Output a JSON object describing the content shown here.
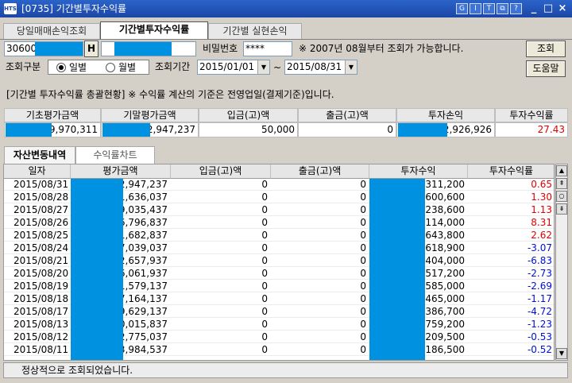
{
  "window": {
    "title": "[0735] 기간별투자수익률",
    "app_badge": "HTS",
    "toolbar_buttons": [
      "G",
      "I",
      "T",
      "⧉",
      "?"
    ],
    "minimize": "_",
    "restore": "□",
    "close": "×"
  },
  "tabs": [
    "당일매매손익조회",
    "기간별투자수익률",
    "기간별 실현손익"
  ],
  "active_tab": 1,
  "form": {
    "account_value": "30600",
    "account_suffix": "H",
    "password_label": "비밀번호",
    "password_value": "****",
    "notice": "※ 2007년 08월부터 조회가 가능합니다.",
    "query_button": "조회",
    "help_button": "도움말",
    "type_label": "조회구분",
    "radio_daily": "일별",
    "radio_monthly": "월별",
    "period_label": "조회기간",
    "start_date": "2015/01/01",
    "tilde": "~",
    "end_date": "2015/08/31"
  },
  "summary": {
    "note": "[기간별 투자수익률 총괄현황] ※ 수익률 계산의 기준은 전영업일(결제기준)입니다.",
    "headers": [
      "기초평가금액",
      "기말평가금액",
      "입금(고)액",
      "출금(고)액",
      "투자손익",
      "투자수익률"
    ],
    "values": [
      "19,970,311",
      "2,947,237",
      "50,000",
      "0",
      "2,926,926",
      "27.43"
    ]
  },
  "subtabs": [
    "자산변동내역",
    "수익률차트"
  ],
  "grid": {
    "columns": [
      "일자",
      "평가금액",
      "입금(고)액",
      "출금(고)액",
      "투자수익",
      "투자수익률"
    ],
    "rows": [
      [
        "2015/08/31",
        "2,947,237",
        "0",
        "0",
        ",311,200",
        "0.65"
      ],
      [
        "2015/08/28",
        "1,636,037",
        "0",
        "0",
        ",600,600",
        "1.30"
      ],
      [
        "2015/08/27",
        "9,035,437",
        "0",
        "0",
        ",238,600",
        "1.13"
      ],
      [
        "2015/08/26",
        "6,796,837",
        "0",
        "0",
        ",114,000",
        "8.31"
      ],
      [
        "2015/08/25",
        "1,682,837",
        "0",
        "0",
        ",643,800",
        "2.62"
      ],
      [
        "2015/08/24",
        "7,039,037",
        "0",
        "0",
        ",618,900",
        "-3.07"
      ],
      [
        "2015/08/21",
        "2,657,937",
        "0",
        "0",
        ",404,000",
        "-6.83"
      ],
      [
        "2015/08/20",
        "6,061,937",
        "0",
        "0",
        ",517,200",
        "-2.73"
      ],
      [
        "2015/08/19",
        "1,579,137",
        "0",
        "0",
        ",585,000",
        "-2.69"
      ],
      [
        "2015/08/18",
        "7,164,137",
        "0",
        "0",
        ",465,000",
        "-1.17"
      ],
      [
        "2015/08/17",
        "9,629,137",
        "0",
        "0",
        ",386,700",
        "-4.72"
      ],
      [
        "2015/08/13",
        "0,015,837",
        "0",
        "0",
        ",759,200",
        "-1.23"
      ],
      [
        "2015/08/12",
        "2,775,037",
        "0",
        "0",
        ",209,500",
        "-0.53"
      ],
      [
        "2015/08/11",
        "3,984,537",
        "0",
        "0",
        ",186,500",
        "-0.52"
      ]
    ]
  },
  "status": "정상적으로 조회되었습니다.",
  "colors": {
    "mask": "#0091e0",
    "positive": "#e00000",
    "negative": "#0010d0",
    "titlebar": "#1b47a6"
  }
}
